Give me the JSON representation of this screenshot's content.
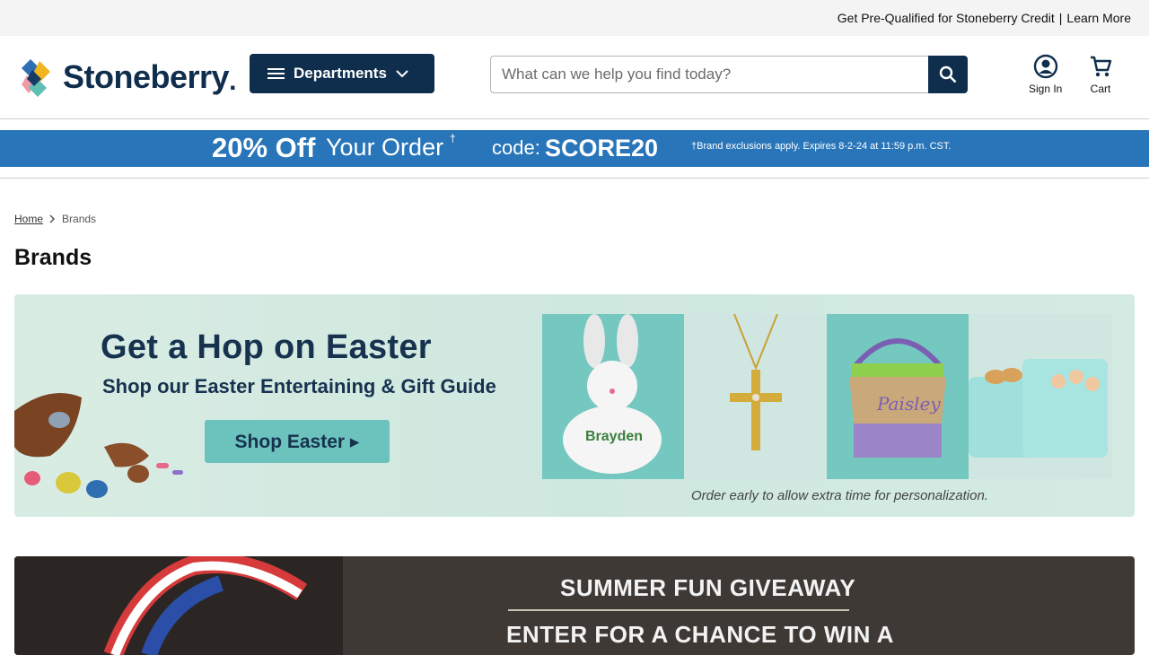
{
  "topbar": {
    "credit_text": "Get Pre-Qualified for Stoneberry Credit",
    "separator": "|",
    "learn_more": "Learn More"
  },
  "header": {
    "logo_text": "Stoneberry",
    "departments_label": "Departments",
    "search_placeholder": "What can we help you find today?",
    "sign_in_label": "Sign In",
    "cart_label": "Cart"
  },
  "promo": {
    "discount": "20% Off",
    "your_order": "Your Order",
    "dagger": "†",
    "code_label": "code:",
    "code_value": "SCORE20",
    "disclaimer": "†Brand exclusions apply. Expires 8-2-24 at 11:59 p.m. CST."
  },
  "breadcrumb": {
    "home": "Home",
    "current": "Brands"
  },
  "page_title": "Brands",
  "easter_banner": {
    "headline": "Get a Hop on Easter",
    "subheadline": "Shop our Easter Entertaining & Gift Guide",
    "cta_label": "Shop Easter ▸",
    "bunny_name": "Brayden",
    "basket_name": "Paisley",
    "note": "Order early to allow extra time for personalization."
  },
  "summer_banner": {
    "line1": "SUMMER FUN GIVEAWAY",
    "line2": "ENTER FOR A CHANCE TO WIN A"
  },
  "colors": {
    "navy": "#0f2d4d",
    "promo_blue": "#2875b9",
    "teal": "#6cc3bd"
  }
}
